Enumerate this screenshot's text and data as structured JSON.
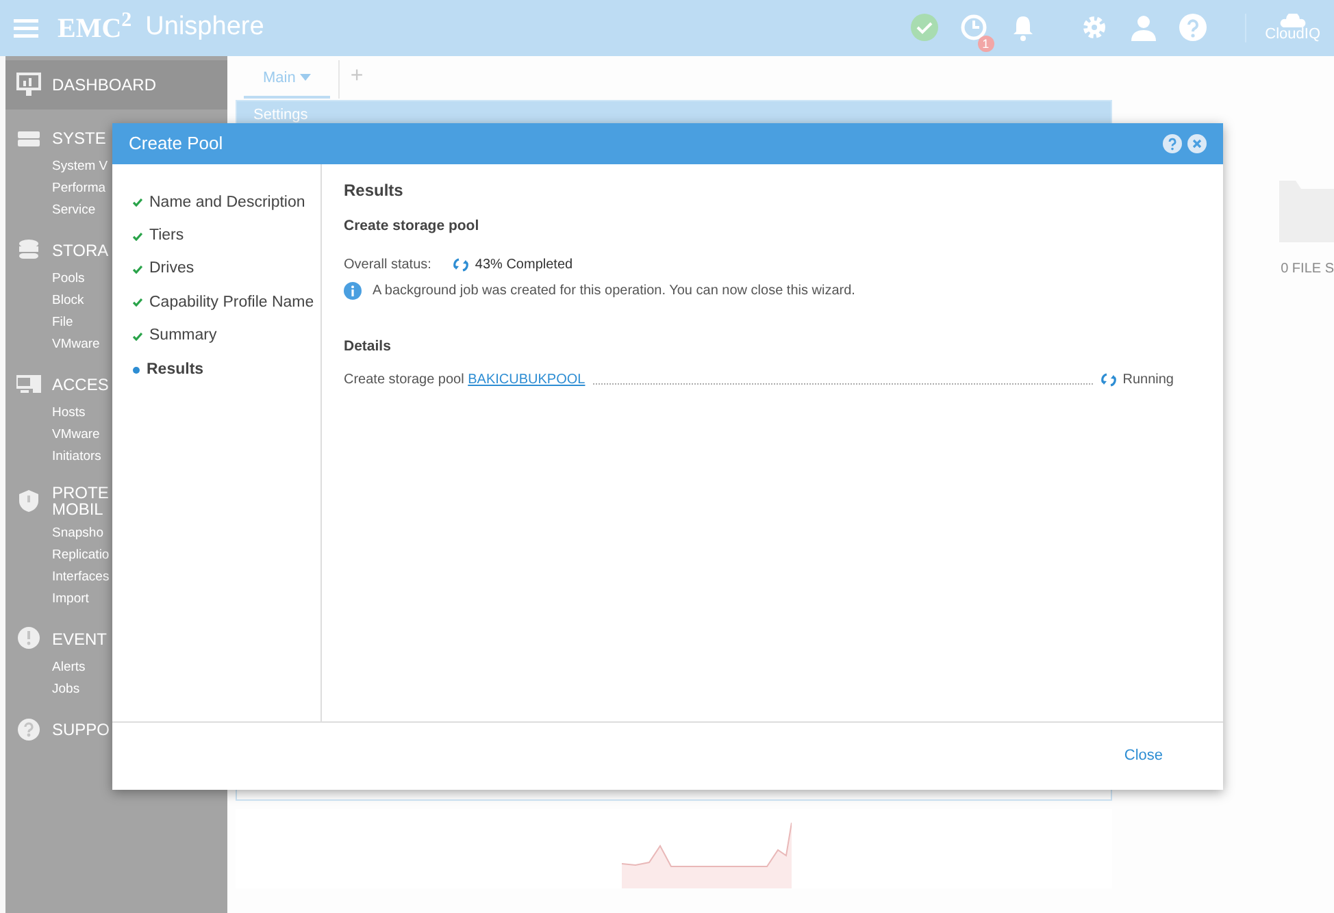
{
  "header": {
    "logo": "EMC$^{2}$",
    "product": "Unisphere",
    "alerts_badge": "1",
    "cloud_label": "CloudIQ"
  },
  "sidebar": {
    "items": [
      {
        "label": "DASHBOARD",
        "selected": true
      },
      {
        "label": "SYSTE",
        "selected": false,
        "children": [
          "System V",
          "Performa",
          "Service"
        ]
      },
      {
        "label": "STORA",
        "selected": false,
        "children": [
          "Pools",
          "Block",
          "File",
          "VMware"
        ]
      },
      {
        "label": "ACCES",
        "selected": false,
        "children": [
          "Hosts",
          "VMware",
          "Initiators"
        ]
      },
      {
        "label": "PROTE\nMOBIL",
        "selected": false,
        "children": [
          "Snapsho",
          "Replicatio",
          "Interfaces",
          "Import"
        ]
      },
      {
        "label": "EVENT",
        "selected": false,
        "children": [
          "Alerts",
          "Jobs"
        ]
      },
      {
        "label": "SUPPO",
        "selected": false
      }
    ]
  },
  "tabs": [
    {
      "label": "Main",
      "selected": true
    }
  ],
  "add_tab": "+",
  "background_panel": {
    "title": "Settings",
    "side_text": "0 FILE S"
  },
  "dialog": {
    "title": "Create Pool",
    "steps": [
      {
        "label": "Name and Description",
        "done": true,
        "selected": false
      },
      {
        "label": "Tiers",
        "done": true,
        "selected": false
      },
      {
        "label": "Drives",
        "done": true,
        "selected": false
      },
      {
        "label": "Capability Profile Name",
        "done": true,
        "selected": false
      },
      {
        "label": "Summary",
        "done": true,
        "selected": false
      },
      {
        "label": "Results",
        "done": false,
        "selected": true
      }
    ],
    "heading": "Results",
    "subheading": "Create storage pool",
    "status_label": "Overall status:",
    "status_value": "43% Completed",
    "info": "A background job was created for this operation. You can now close this wizard.",
    "details_heading": "Details",
    "tasks": [
      {
        "label": "Create storage pool",
        "link": "BAKICUBUKPOOL",
        "status": "Running"
      }
    ],
    "close": "Close"
  }
}
